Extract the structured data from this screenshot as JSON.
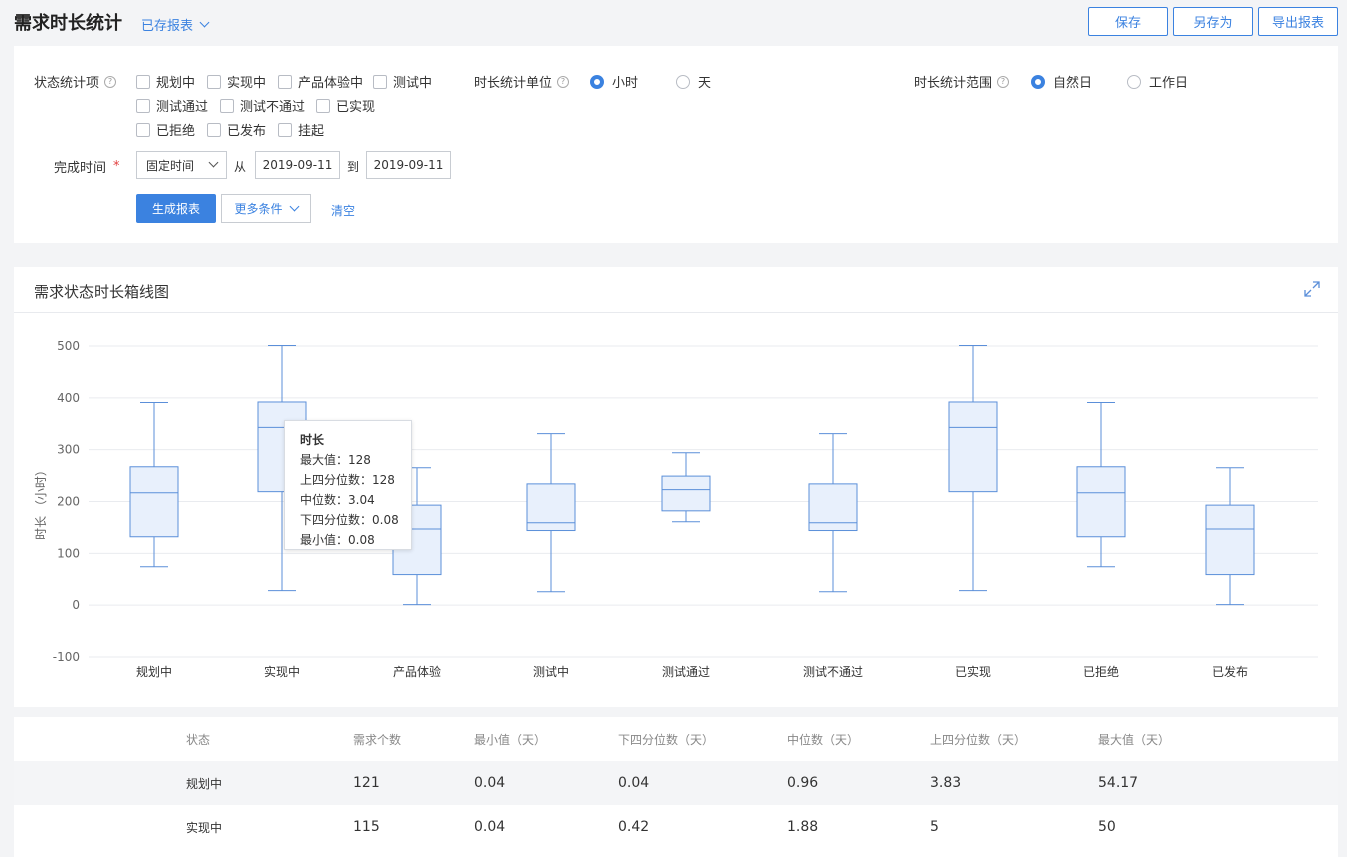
{
  "header": {
    "title": "需求时长统计",
    "saved_reports": "已存报表",
    "buttons": {
      "save": "保存",
      "save_as": "另存为",
      "export": "导出报表"
    }
  },
  "filters": {
    "status_items": {
      "label": "状态统计项",
      "options": [
        "规划中",
        "实现中",
        "产品体验中",
        "测试中",
        "测试通过",
        "测试不通过",
        "已实现",
        "已拒绝",
        "已发布",
        "挂起"
      ]
    },
    "unit": {
      "label": "时长统计单位",
      "options": [
        "小时",
        "天"
      ],
      "selected": "小时"
    },
    "range": {
      "label": "时长统计范围",
      "options": [
        "自然日",
        "工作日"
      ],
      "selected": "自然日"
    },
    "completion_time": {
      "label": "完成时间",
      "required_mark": "*",
      "mode": "固定时间",
      "from_label": "从",
      "from": "2019-09-11",
      "to_label": "到",
      "to": "2019-09-11"
    },
    "actions": {
      "generate": "生成报表",
      "more": "更多条件",
      "clear": "清空"
    }
  },
  "chart": {
    "title": "需求状态时长箱线图",
    "tooltip": {
      "title": "时长",
      "lines": [
        "最大值：128",
        "上四分位数：128",
        "中位数：3.04",
        "下四分位数：0.08",
        "最小值：0.08"
      ]
    }
  },
  "chart_data": {
    "type": "boxplot",
    "ylabel": "时长 （小时）",
    "ylim": [
      -100,
      500
    ],
    "yticks": [
      -100,
      0,
      100,
      200,
      300,
      400,
      500
    ],
    "grid": true,
    "categories": [
      "规划中",
      "实现中",
      "产品体验",
      "测试中",
      "测试通过",
      "测试不通过",
      "已实现",
      "已拒绝",
      "已发布"
    ],
    "boxes": [
      {
        "min": 74,
        "q1": 132,
        "median": 217,
        "q3": 267,
        "max": 391
      },
      {
        "min": 28,
        "q1": 219,
        "median": 343,
        "q3": 392,
        "max": 501
      },
      {
        "min": 1,
        "q1": 59,
        "median": 147,
        "q3": 193,
        "max": 265
      },
      {
        "min": 26,
        "q1": 144,
        "median": 159,
        "q3": 234,
        "max": 331
      },
      {
        "min": 161,
        "q1": 182,
        "median": 223,
        "q3": 249,
        "max": 294
      },
      {
        "min": 26,
        "q1": 144,
        "median": 159,
        "q3": 234,
        "max": 331
      },
      {
        "min": 28,
        "q1": 219,
        "median": 343,
        "q3": 392,
        "max": 501
      },
      {
        "min": 74,
        "q1": 132,
        "median": 217,
        "q3": 267,
        "max": 391
      },
      {
        "min": 1,
        "q1": 59,
        "median": 147,
        "q3": 193,
        "max": 265
      }
    ]
  },
  "table": {
    "columns": [
      "状态",
      "需求个数",
      "最小值（天）",
      "下四分位数（天）",
      "中位数（天）",
      "上四分位数（天）",
      "最大值（天）"
    ],
    "rows": [
      [
        "规划中",
        "121",
        "0.04",
        "0.04",
        "0.96",
        "3.83",
        "54.17"
      ],
      [
        "实现中",
        "115",
        "0.04",
        "0.42",
        "1.88",
        "5",
        "50"
      ]
    ]
  },
  "colors": {
    "accent": "#3b82e0",
    "box_fill": "#e8f0fc",
    "box_stroke": "#5b8fd9"
  }
}
